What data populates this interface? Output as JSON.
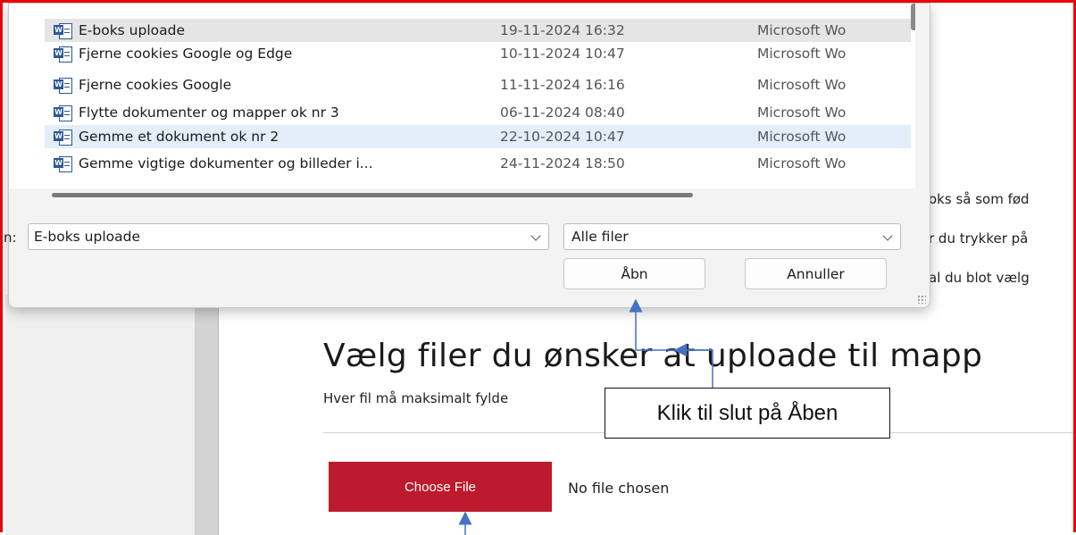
{
  "dialog": {
    "files": [
      {
        "name": "E-boks uploade",
        "date": "19-11-2024 16:32",
        "type": "Microsoft Wo",
        "state": "hover"
      },
      {
        "name": "Fjerne cookies Google og Edge",
        "date": "10-11-2024 10:47",
        "type": "Microsoft Wo",
        "state": ""
      },
      {
        "name": "Fjerne cookies Google",
        "date": "11-11-2024 16:16",
        "type": "Microsoft Wo",
        "state": ""
      },
      {
        "name": "Flytte dokumenter og mapper ok nr 3",
        "date": "06-11-2024 08:40",
        "type": "Microsoft Wo",
        "state": ""
      },
      {
        "name": "Gemme et dokument ok nr 2",
        "date": "22-10-2024 10:47",
        "type": "Microsoft Wo",
        "state": "sel"
      },
      {
        "name": "Gemme vigtige dokumenter og billeder i...",
        "date": "24-11-2024 18:50",
        "type": "Microsoft Wo",
        "state": ""
      }
    ],
    "file_icon": "word-document-icon",
    "filename_label": "n:",
    "filename_value": "E-boks uploade",
    "filter_value": "Alle filer",
    "open_label": "Åbn",
    "cancel_label": "Annuller"
  },
  "page": {
    "fragment_1": "oks så som fød",
    "fragment_2": "r du trykker på",
    "fragment_3": "al du blot vælg",
    "heading": "Vælg filer du ønsker at uploade til mapp",
    "subtext": "Hver fil må maksimalt fylde",
    "choose_file_label": "Choose File",
    "no_file_label": "No file chosen"
  },
  "annotation": {
    "callout_text": "Klik til slut på Åben",
    "arrow_color": "#4472c4",
    "frame_color": "#e8000b"
  },
  "colors": {
    "choose_button": "#be1a2d",
    "selected_row": "#e3eef9",
    "hover_row": "#e5e5e5"
  }
}
